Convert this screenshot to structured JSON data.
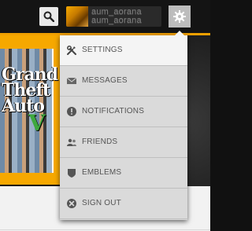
{
  "topbar": {
    "search_icon": "search-icon",
    "user": {
      "name_line1": "aum_aorana",
      "name_line2": "aum_aorana"
    },
    "settings_icon": "gear-icon"
  },
  "game": {
    "title": "Grand Theft Auto",
    "numeral": "V"
  },
  "menu": {
    "items": [
      {
        "label": "SETTINGS",
        "icon": "wrench-screwdriver-icon",
        "active": true
      },
      {
        "label": "MESSAGES",
        "icon": "envelope-icon"
      },
      {
        "label": "NOTIFICATIONS",
        "icon": "alert-icon"
      },
      {
        "label": "FRIENDS",
        "icon": "friends-icon"
      },
      {
        "label": "EMBLEMS",
        "icon": "emblem-icon"
      },
      {
        "label": "SIGN OUT",
        "icon": "close-circle-icon"
      }
    ]
  },
  "colors": {
    "accent": "#f0a000",
    "menu_bg": "#dadada",
    "menu_active_bg": "#f4f4f4",
    "label": "#555555"
  }
}
